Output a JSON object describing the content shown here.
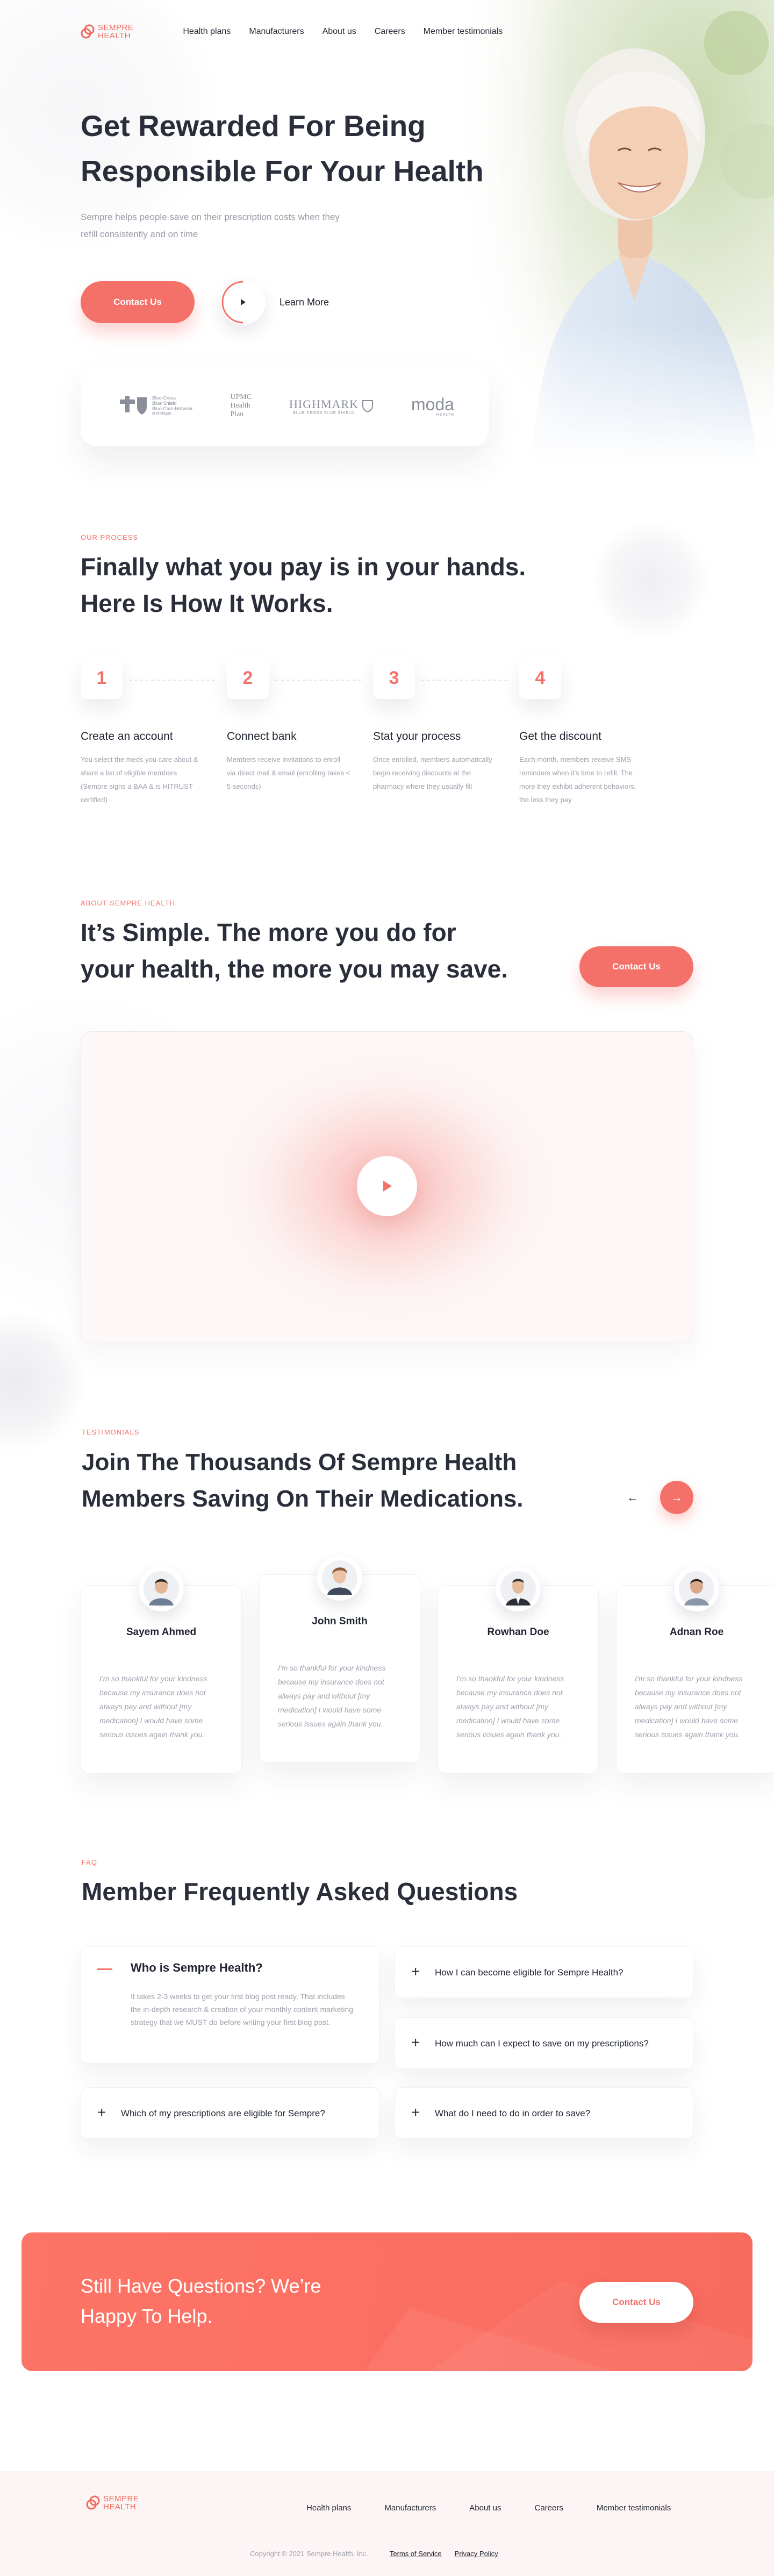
{
  "brand": {
    "name_line1": "SEMPRE",
    "name_line2": "HEALTH",
    "accent": "#f4716a"
  },
  "nav": {
    "items": [
      "Health plans",
      "Manufacturers",
      "About us",
      "Careers",
      "Member testimonials"
    ]
  },
  "hero": {
    "title": "Get Rewarded For Being Responsible For Your Health",
    "subtitle": "Sempre helps people save on their prescription costs when they refill consistently and on time",
    "contact_label": "Contact Us",
    "learn_label": "Learn More",
    "partners": [
      {
        "name": "Blue Cross Blue Shield Blue Care Network",
        "lines": [
          "Blue Cross",
          "Blue Shield",
          "Blue Care Network"
        ],
        "sub": "of Michigan"
      },
      {
        "name": "UPMC Health Plan",
        "lines": [
          "UPMC",
          "Health",
          "Plan"
        ]
      },
      {
        "name": "HIGHMARK",
        "lines": [
          "HIGHMARK"
        ],
        "sub": "BLUE CROSS BLUE SHIELD"
      },
      {
        "name": "moda",
        "lines": [
          "moda"
        ],
        "sub": "HEALTH"
      }
    ]
  },
  "process": {
    "eyebrow": "OUR PROCESS",
    "title_line1": "Finally what you pay is in your hands.",
    "title_line2": "Here Is How It Works.",
    "steps": [
      {
        "num": "1",
        "title": "Create an account",
        "text": "You select the meds you care about & share a list of eligible members (Sempre signs a BAA & is HITRUST certified)"
      },
      {
        "num": "2",
        "title": "Connect bank",
        "text": "Members receive invitations to enroll via direct mail & email (enrolling takes < 5 seconds)"
      },
      {
        "num": "3",
        "title": "Stat your process",
        "text": "Once enrolled, members automatically begin receiving discounts at the pharmacy where they usually fill"
      },
      {
        "num": "4",
        "title": "Get the discount",
        "text": "Each month, members receive SMS reminders when it's time to refill. The more they exhibit adherent behaviors, the less they pay"
      }
    ]
  },
  "about": {
    "eyebrow": "ABOUT SEMPRE HEALTH",
    "title_line1": "It’s Simple. The more you do for",
    "title_line2": "your health, the more you may save.",
    "contact_label": "Contact Us"
  },
  "testimonials": {
    "eyebrow": "TESTIMONIALS",
    "title_line1": "Join The Thousands Of Sempre Health",
    "title_line2": "Members Saving On Their Medications.",
    "items": [
      {
        "name": "Sayem Ahmed",
        "quote": "I'm so thankful for your kindness because my insurance does not always pay and without [my medication] I would have some serious issues again thank you."
      },
      {
        "name": "John Smith",
        "quote": "I'm so thankful for your kindness because my insurance does not always pay and without [my medication] I would have some serious issues again thank you."
      },
      {
        "name": "Rowhan Doe",
        "quote": "I'm so thankful for your kindness because my insurance does not always pay and without [my medication] I would have some serious issues again thank you."
      },
      {
        "name": "Adnan Roe",
        "quote": "I'm so thankful for your kindness because my insurance does not always pay and without [my medication] I would have some serious issues again thank you."
      }
    ]
  },
  "faq": {
    "eyebrow": "FAQ",
    "title": "Member Frequently Asked Questions",
    "open": {
      "question": "Who is Sempre Health?",
      "answer": "It takes 2-3 weeks to get your first blog post ready. That includes the in-depth research & creation of your monthly content marketing strategy that we MUST do before writing your first blog post."
    },
    "questions": [
      "Which of my prescriptions are eligible for Sempre?",
      "How I can become eligible for Sempre Health?",
      "How much can I expect to save on my prescriptions?",
      "What do I need to do in order to save?"
    ]
  },
  "cta": {
    "title_line1": "Still Have Questions? We’re",
    "title_line2": "Happy To Help.",
    "button_label": "Contact Us"
  },
  "footer": {
    "links": [
      "Health plans",
      "Manufacturers",
      "About us",
      "Careers",
      "Member testimonials"
    ],
    "copyright": "Copyright © 2021 Sempre Health, Inc.",
    "terms": "Terms of Service",
    "privacy": "Privacy Policy"
  }
}
